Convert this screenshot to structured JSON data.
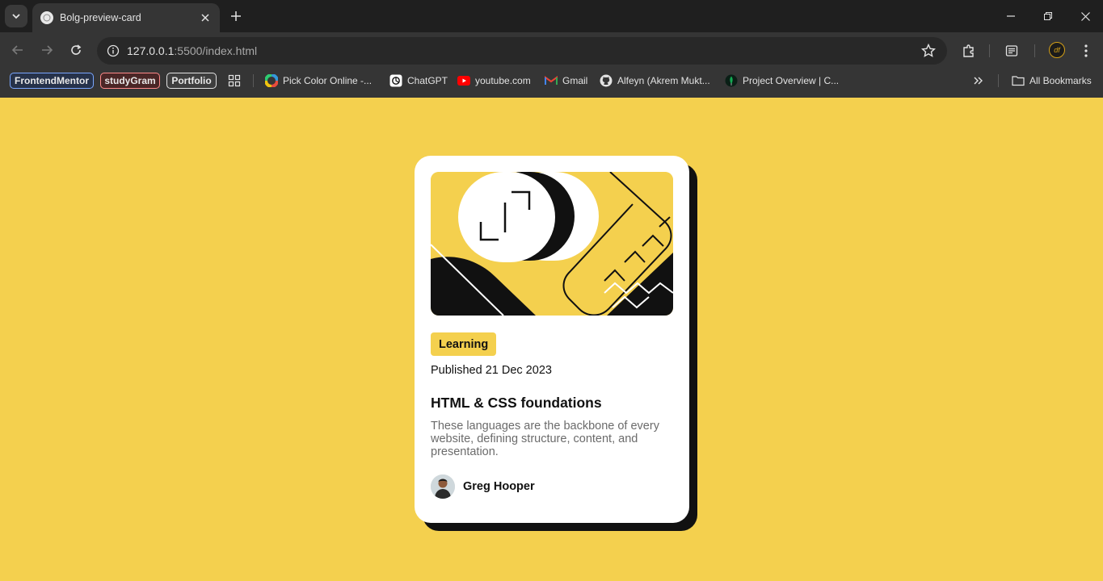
{
  "browser": {
    "tab": {
      "title": "Bolg-preview-card"
    },
    "url": {
      "host": "127.0.0.1",
      "path": ":5500/index.html"
    },
    "profile": "df",
    "bookmarks": {
      "chips": [
        {
          "label": "FrontendMentor",
          "color": "#7aa7ff"
        },
        {
          "label": "studyGram",
          "color": "#ff8a8a"
        },
        {
          "label": "Portfolio",
          "color": "#e3e3e3"
        }
      ],
      "items": [
        {
          "label": "Pick Color Online -...",
          "icon": "color-wheel-icon"
        },
        {
          "label": "ChatGPT",
          "icon": "chatgpt-icon"
        },
        {
          "label": "youtube.com",
          "icon": "youtube-icon"
        },
        {
          "label": "Gmail",
          "icon": "gmail-icon"
        },
        {
          "label": "Alfeyn (Akrem Mukt...",
          "icon": "github-icon"
        },
        {
          "label": "Project Overview | C...",
          "icon": "mongodb-icon"
        }
      ],
      "all_bookmarks": "All Bookmarks"
    }
  },
  "card": {
    "tag": "Learning",
    "published": "Published 21 Dec 2023",
    "title": "HTML & CSS foundations",
    "description": "These languages are the backbone of every website, defining structure, content, and presentation.",
    "author": "Greg Hooper"
  },
  "colors": {
    "page_bg": "#f4d04e",
    "card_bg": "#ffffff",
    "shadow": "#111111"
  }
}
